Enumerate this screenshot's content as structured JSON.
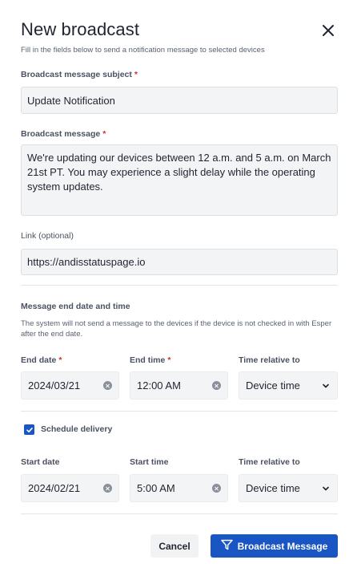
{
  "header": {
    "title": "New broadcast",
    "subtitle": "Fill in the fields below to send a notification message to selected devices"
  },
  "subject": {
    "label": "Broadcast message subject",
    "required_mark": "*",
    "value": "Update Notification"
  },
  "message": {
    "label": "Broadcast message",
    "required_mark": "*",
    "value": "We're updating our devices between 12 a.m. and 5 a.m. on March 21st PT. You may experience a slight delay while the operating system updates."
  },
  "link": {
    "label": "Link (optional)",
    "value": "https://andisstatuspage.io"
  },
  "end_section": {
    "title": "Message end date and time",
    "description": "The system will not send a message to the devices if the device is not checked in with Esper after the end date.",
    "end_date_label": "End date",
    "end_date_required": "*",
    "end_date_value": "2024/03/21",
    "end_time_label": "End time",
    "end_time_required": "*",
    "end_time_value": "12:00 AM",
    "relative_label": "Time relative to",
    "relative_value": "Device time"
  },
  "schedule": {
    "checkbox_label": "Schedule delivery",
    "checked": true,
    "start_date_label": "Start date",
    "start_date_value": "2024/02/21",
    "start_time_label": "Start time",
    "start_time_value": "5:00 AM",
    "relative_label": "Time relative to",
    "relative_value": "Device time"
  },
  "footer": {
    "cancel_label": "Cancel",
    "submit_label": "Broadcast Message"
  },
  "colors": {
    "primary": "#1a55c4",
    "required": "#d32f2f",
    "field_bg": "#f3f4f6"
  },
  "icons": {
    "close": "close-icon",
    "clear": "clear-circle-icon",
    "dropdown": "chevron-down-icon",
    "send": "send-icon",
    "check": "check-icon"
  }
}
